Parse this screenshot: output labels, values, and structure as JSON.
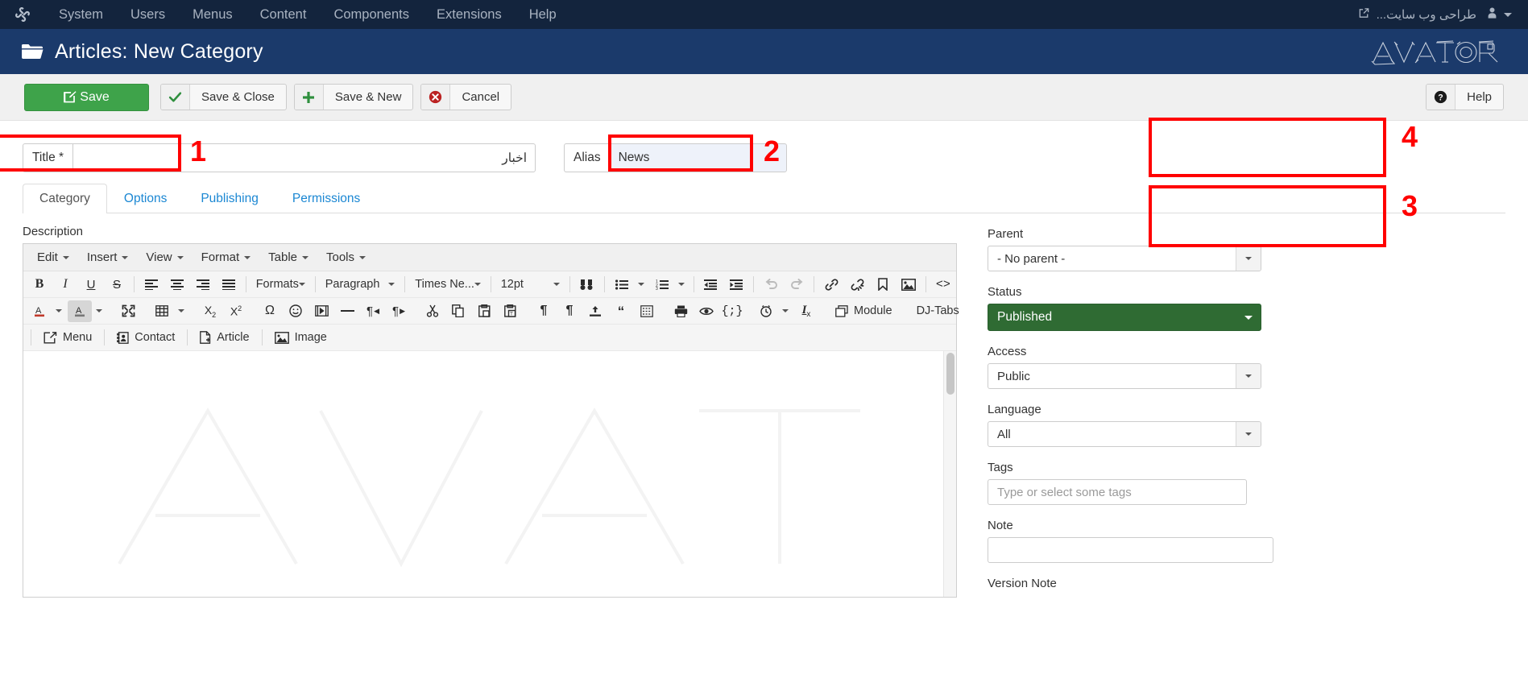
{
  "admin_bar": {
    "logo_icon": "joomla-logo-icon",
    "menu": [
      {
        "label": "System"
      },
      {
        "label": "Users"
      },
      {
        "label": "Menus"
      },
      {
        "label": "Content"
      },
      {
        "label": "Components"
      },
      {
        "label": "Extensions"
      },
      {
        "label": "Help"
      }
    ],
    "site_link_label": "طراحی وب سایت...",
    "site_link_icon": "external-link-icon",
    "user_icon": "user-avatar-icon",
    "user_caret_icon": "chevron-down-icon"
  },
  "page_header": {
    "icon": "folder-icon",
    "title": "Articles: New Category",
    "brand_logo": "avatar-logo"
  },
  "toolbar": {
    "save_label": "Save",
    "save_icon": "pencil-square-icon",
    "save_close_label": "Save & Close",
    "save_close_icon": "check-icon",
    "save_new_label": "Save & New",
    "save_new_icon": "plus-icon",
    "cancel_label": "Cancel",
    "cancel_icon": "times-circle-icon",
    "help_label": "Help",
    "help_icon": "question-circle-icon"
  },
  "form": {
    "title_label": "Title *",
    "title_value": "اخبار",
    "alias_label": "Alias",
    "alias_value": "News"
  },
  "annotations": [
    {
      "number": "1",
      "target": "title-field"
    },
    {
      "number": "2",
      "target": "alias-field"
    },
    {
      "number": "3",
      "target": "status-field"
    },
    {
      "number": "4",
      "target": "parent-field"
    }
  ],
  "tabs": [
    {
      "label": "Category",
      "active": true
    },
    {
      "label": "Options",
      "active": false
    },
    {
      "label": "Publishing",
      "active": false
    },
    {
      "label": "Permissions",
      "active": false
    }
  ],
  "editor": {
    "description_label": "Description",
    "menubar": [
      {
        "label": "Edit"
      },
      {
        "label": "Insert"
      },
      {
        "label": "View"
      },
      {
        "label": "Format"
      },
      {
        "label": "Table"
      },
      {
        "label": "Tools"
      }
    ],
    "formats_label": "Formats",
    "paragraph_label": "Paragraph",
    "font_label": "Times Ne...",
    "fontsize_label": "12pt",
    "module_label": "Module",
    "djtabs_label": "DJ-Tabs",
    "menu_btn_label": "Menu",
    "contact_btn_label": "Contact",
    "article_btn_label": "Article",
    "image_btn_label": "Image"
  },
  "sidebar": {
    "parent_label": "Parent",
    "parent_value": "- No parent -",
    "status_label": "Status",
    "status_value": "Published",
    "status_color": "#2f6b33",
    "access_label": "Access",
    "access_value": "Public",
    "language_label": "Language",
    "language_value": "All",
    "tags_label": "Tags",
    "tags_placeholder": "Type or select some tags",
    "note_label": "Note",
    "note_value": "",
    "version_note_label": "Version Note"
  },
  "colors": {
    "admin_bar": "#13243d",
    "page_header": "#1b3a6b",
    "save_green": "#3ea34a",
    "annotation_red": "#ff0000",
    "link_blue": "#1b87d3"
  }
}
